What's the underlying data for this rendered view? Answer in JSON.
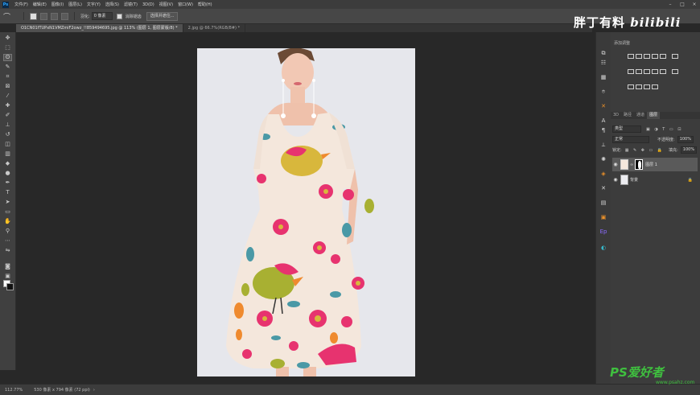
{
  "menubar": {
    "app_icon": "Ps",
    "items": [
      "文件(F)",
      "编辑(E)",
      "图像(I)",
      "图层(L)",
      "文字(Y)",
      "选择(S)",
      "滤镜(T)",
      "3D(D)",
      "视图(V)",
      "窗口(W)",
      "帮助(H)"
    ]
  },
  "options": {
    "feather_label": "羽化:",
    "feather_value": "0 像素",
    "antialias_label": "消除锯齿",
    "select_mask_label": "选择并遮住..."
  },
  "tabs": [
    {
      "label": "O1CN01fTUPxN1VMZmiF2owz_!!859494695.jpg @ 113% (图层 1, 图层蒙版/8) *"
    },
    {
      "label": "2.jpg @ 66.7%(RGB/8#) *"
    }
  ],
  "panels": {
    "adjustments_title": "添加调整",
    "tabs": [
      "3D",
      "路径",
      "通道",
      "图层"
    ],
    "active_tab_index": 3,
    "filter_kind": "类型",
    "blend_mode": "正常",
    "opacity_label": "不透明度:",
    "opacity_value": "100%",
    "lock_label": "锁定:",
    "fill_label": "填充:",
    "fill_value": "100%",
    "layers": [
      {
        "name": "图层 1",
        "selected": true
      },
      {
        "name": "背景",
        "selected": false
      }
    ]
  },
  "status": {
    "zoom": "112.77%",
    "doc_info": "530 像素 x 794 像素 (72 ppi)"
  },
  "watermarks": {
    "top_cn": "胖丁有料",
    "top_logo": "bilibili",
    "bottom_logo": "PS爱好者",
    "bottom_url": "www.psahz.com"
  },
  "colors": {
    "dress_bg": "#f4e7dc",
    "pink": "#e7336f",
    "yellow": "#d8b73c",
    "olive": "#a8b032",
    "teal": "#4a99a6",
    "orange": "#ef8a2e"
  }
}
